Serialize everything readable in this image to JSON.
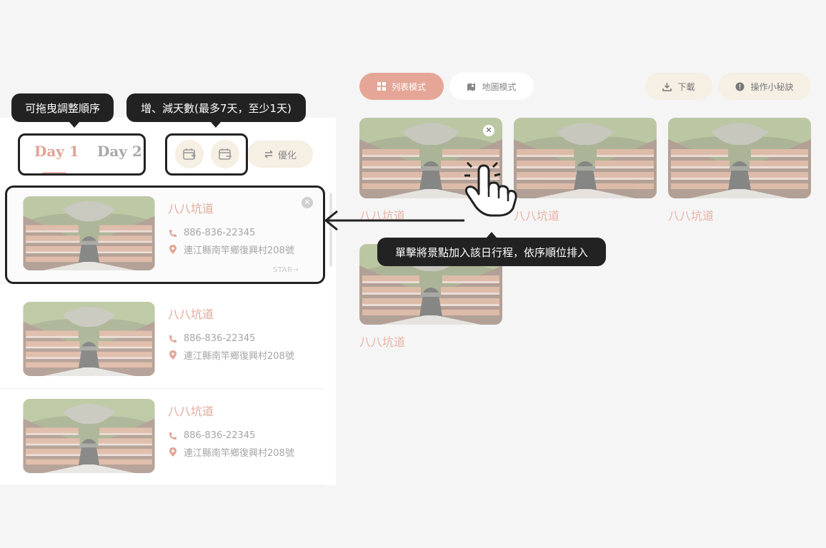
{
  "header": {
    "tabs": [
      {
        "label": "Day 1"
      },
      {
        "label": "Day 2"
      }
    ],
    "optimize_label": "優化"
  },
  "view_modes": [
    {
      "label": "列表模式"
    },
    {
      "label": "地圖模式"
    }
  ],
  "actions": {
    "download_label": "下載",
    "tips_label": "操作小秘訣"
  },
  "itinerary": [
    {
      "name": "八八坑道",
      "phone": "886-836-22345",
      "address": "連江縣南竿鄉復興村208號",
      "star": "STAR"
    },
    {
      "name": "八八坑道",
      "phone": "886-836-22345",
      "address": "連江縣南竿鄉復興村208號"
    },
    {
      "name": "八八坑道",
      "phone": "886-836-22345",
      "address": "連江縣南竿鄉復興村208號"
    }
  ],
  "attractions": [
    {
      "name": "八八坑道"
    },
    {
      "name": "八八坑道"
    },
    {
      "name": "八八坑道"
    },
    {
      "name": "八八坑道"
    }
  ],
  "tooltips": {
    "drag": "可拖曳調整順序",
    "days": "增、減天數(最多7天，至少1天)",
    "click": "單擊將景點加入該日行程，依序順位排入"
  },
  "colors": {
    "accent": "#e5a697",
    "tooltip": "#222222",
    "button_bg": "#f5efe4"
  }
}
